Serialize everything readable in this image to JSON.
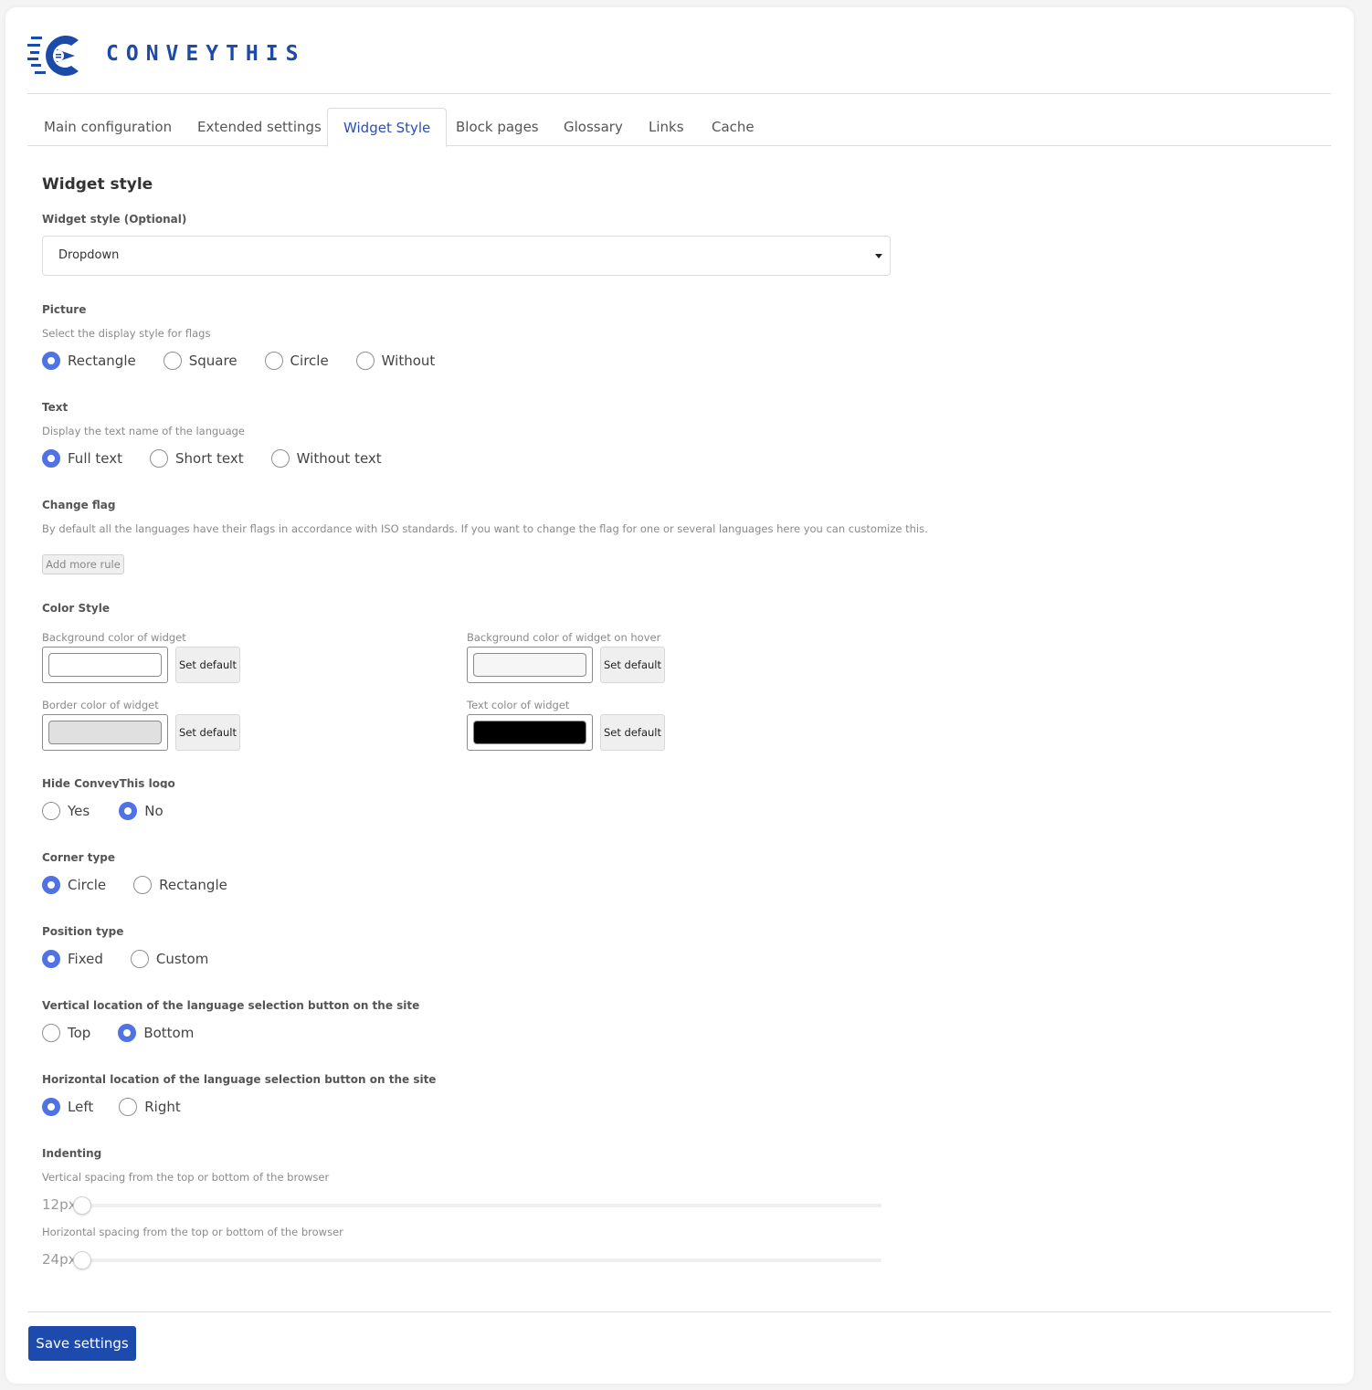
{
  "brand": {
    "name": "CONVEYTHIS",
    "color": "#1c4aa8"
  },
  "tabs": [
    {
      "label": "Main configuration",
      "active": false
    },
    {
      "label": "Extended settings",
      "active": false
    },
    {
      "label": "Widget Style",
      "active": true
    },
    {
      "label": "Block pages",
      "active": false
    },
    {
      "label": "Glossary",
      "active": false
    },
    {
      "label": "Links",
      "active": false
    },
    {
      "label": "Cache",
      "active": false
    }
  ],
  "section_title": "Widget style",
  "widget_style": {
    "label": "Widget style (Optional)",
    "value": "Dropdown"
  },
  "picture": {
    "label": "Picture",
    "hint": "Select the display style for flags",
    "options": [
      "Rectangle",
      "Square",
      "Circle",
      "Without"
    ],
    "selected": "Rectangle"
  },
  "text": {
    "label": "Text",
    "hint": "Display the text name of the language",
    "options": [
      "Full text",
      "Short text",
      "Without text"
    ],
    "selected": "Full text"
  },
  "change_flag": {
    "label": "Change flag",
    "hint": "By default all the languages have their flags in accordance with ISO standards. If you want to change the flag for one or several languages here you can customize this.",
    "button": "Add more rule"
  },
  "color_style": {
    "label": "Color Style",
    "fields": [
      {
        "label": "Background color of widget",
        "color": "#ffffff",
        "button": "Set default"
      },
      {
        "label": "Background color of widget on hover",
        "color": "#f6f6f6",
        "button": "Set default"
      },
      {
        "label": "Border color of widget",
        "color": "#e0e0e0",
        "button": "Set default"
      },
      {
        "label": "Text color of widget",
        "color": "#000000",
        "button": "Set default"
      }
    ]
  },
  "hide_logo": {
    "label": "Hide ConveyThis logo",
    "options": [
      "Yes",
      "No"
    ],
    "selected": "No"
  },
  "corner_type": {
    "label": "Corner type",
    "options": [
      "Circle",
      "Rectangle"
    ],
    "selected": "Circle"
  },
  "position_type": {
    "label": "Position type",
    "options": [
      "Fixed",
      "Custom"
    ],
    "selected": "Fixed"
  },
  "vertical_location": {
    "label": "Vertical location of the language selection button on the site",
    "options": [
      "Top",
      "Bottom"
    ],
    "selected": "Bottom"
  },
  "horizontal_location": {
    "label": "Horizontal location of the language selection button on the site",
    "options": [
      "Left",
      "Right"
    ],
    "selected": "Left"
  },
  "indenting": {
    "label": "Indenting",
    "vertical": {
      "hint": "Vertical spacing from the top or bottom of the browser",
      "value": "12px"
    },
    "horizontal": {
      "hint": "Horizontal spacing from the top or bottom of the browser",
      "value": "24px"
    }
  },
  "save_button": "Save settings",
  "accent_color": "#4f73e3"
}
